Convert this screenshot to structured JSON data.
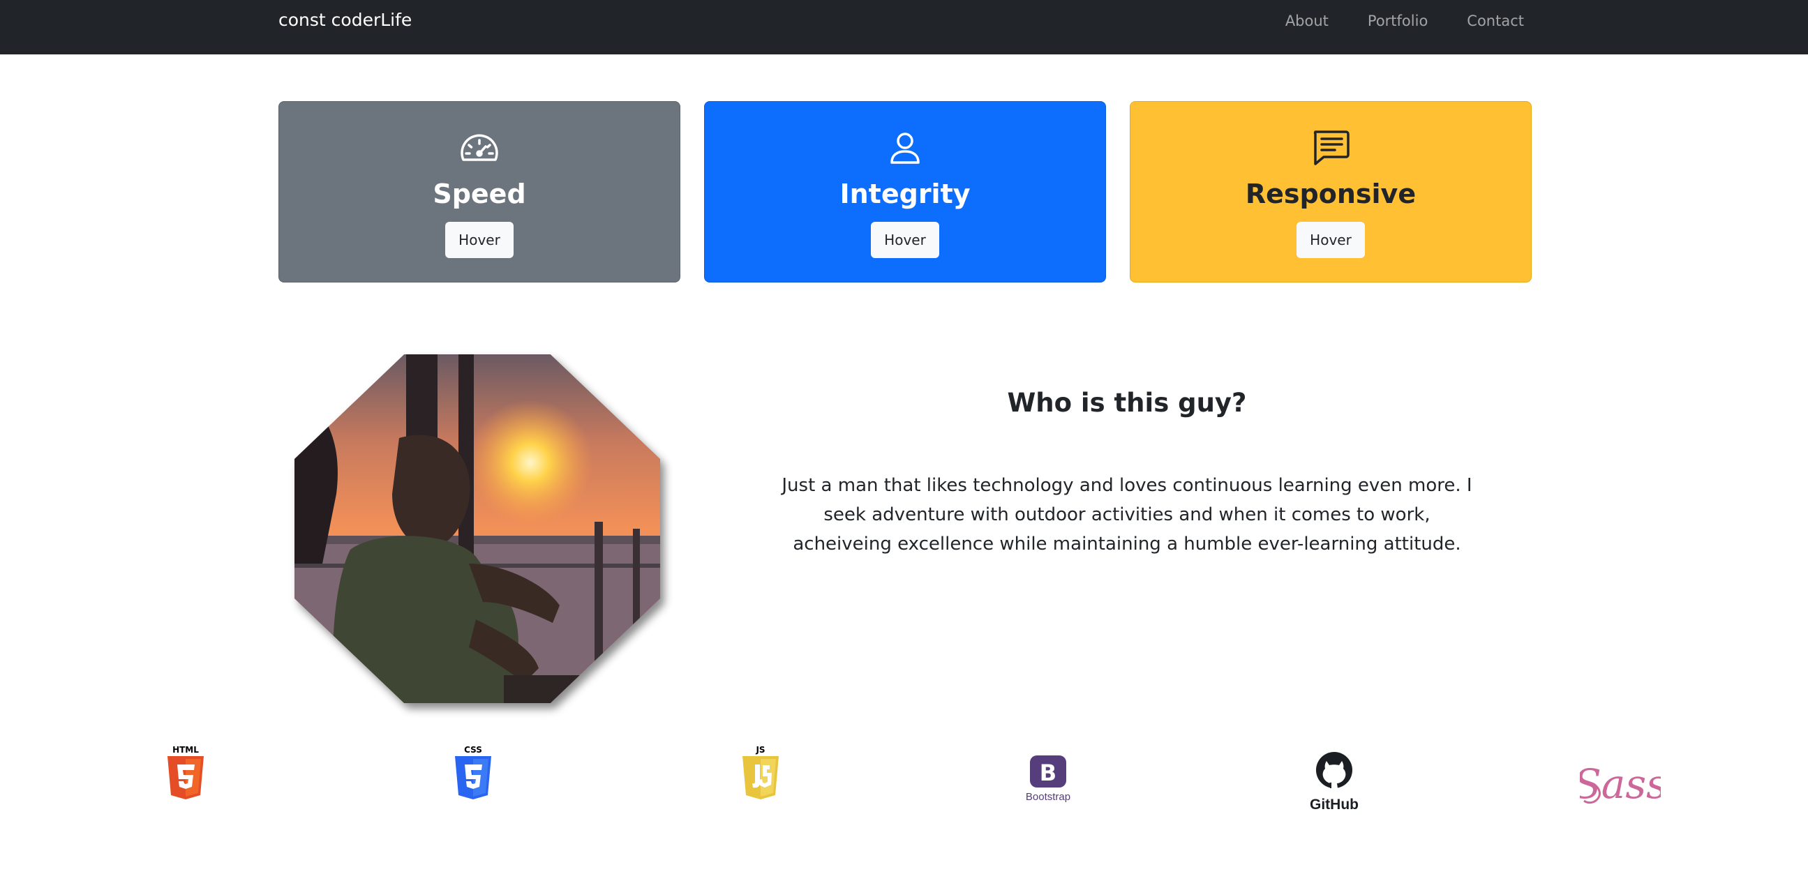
{
  "navbar": {
    "brand": "const coderLife",
    "links": [
      "About",
      "Portfolio",
      "Contact"
    ]
  },
  "cards": [
    {
      "icon": "speedometer-icon",
      "title": "Speed",
      "button": "Hover",
      "color": "#6c757d"
    },
    {
      "icon": "person-icon",
      "title": "Integrity",
      "button": "Hover",
      "color": "#0d6efd"
    },
    {
      "icon": "chat-text-icon",
      "title": "Responsive",
      "button": "Hover",
      "color": "#ffc033"
    }
  ],
  "about": {
    "title": "Who is this guy?",
    "text": "Just a man that likes technology and loves continuous learning even more. I seek adventure with outdoor activities and when it comes to work, acheiveing excellence while maintaining a humble ever-learning attitude."
  },
  "tech_logos": [
    {
      "icon": "html5-logo-icon",
      "label": "HTML",
      "color": "#e44d26"
    },
    {
      "icon": "css3-logo-icon",
      "label": "CSS",
      "color": "#2965f1"
    },
    {
      "icon": "javascript-logo-icon",
      "label": "JS",
      "color": "#e8c53c"
    },
    {
      "icon": "bootstrap-logo-icon",
      "label": "Bootstrap",
      "color": "#563d7c"
    },
    {
      "icon": "github-logo-icon",
      "label": "GitHub",
      "color": "#1b1f23"
    },
    {
      "icon": "sass-logo-icon",
      "label": "Sass",
      "color": "#cd6799"
    }
  ]
}
